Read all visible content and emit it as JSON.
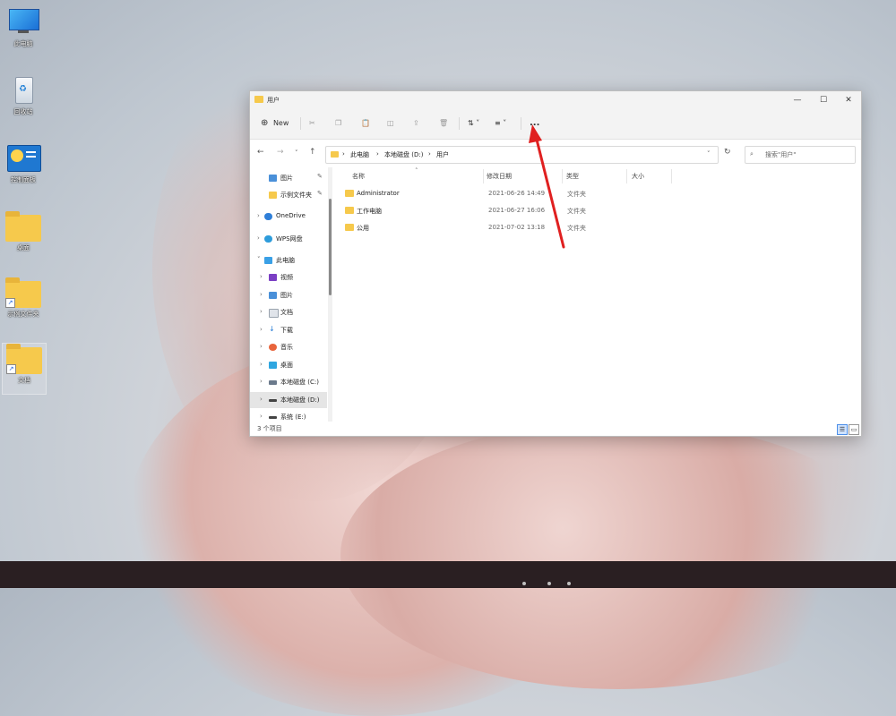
{
  "desktop": {
    "icons": [
      {
        "label": "此电脑",
        "icon": "monitor-icon"
      },
      {
        "label": "回收站",
        "icon": "recycle-bin-icon"
      },
      {
        "label": "控制面板",
        "icon": "control-panel-icon"
      },
      {
        "label": "桌面",
        "icon": "folder-icon"
      },
      {
        "label": "示例文件夹",
        "icon": "folder-shortcut-icon"
      },
      {
        "label": "文档",
        "icon": "folder-shortcut-icon"
      }
    ]
  },
  "window": {
    "title": "用户",
    "controls": {
      "minimize": "—",
      "maximize": "☐",
      "close": "✕"
    },
    "toolbar": {
      "new_label": "New",
      "sort_icon": "sort-icon",
      "view_icon": "view-icon",
      "more_label": "..."
    },
    "address": {
      "segments": [
        "此电脑",
        "本地磁盘 (D:)",
        "用户"
      ],
      "search_placeholder": "搜索\"用户\""
    },
    "nav_pane": [
      {
        "label": "图片",
        "pinned": true
      },
      {
        "label": "示例文件夹",
        "pinned": true
      },
      {
        "label": "OneDrive"
      },
      {
        "label": "WPS网盘"
      },
      {
        "label": "此电脑"
      },
      {
        "label": "视频"
      },
      {
        "label": "图片"
      },
      {
        "label": "文档"
      },
      {
        "label": "下载"
      },
      {
        "label": "音乐"
      },
      {
        "label": "桌面"
      },
      {
        "label": "本地磁盘 (C:)"
      },
      {
        "label": "本地磁盘 (D:)",
        "selected": true
      },
      {
        "label": "系统 (E:)"
      }
    ],
    "columns": [
      "名称",
      "修改日期",
      "类型",
      "大小"
    ],
    "files": [
      {
        "name": "Administrator",
        "date": "2021-06-26 14:49",
        "type": "文件夹"
      },
      {
        "name": "工作电脑",
        "date": "2021-06-27 16:06",
        "type": "文件夹"
      },
      {
        "name": "公用",
        "date": "2021-07-02 13:18",
        "type": "文件夹"
      }
    ],
    "status": "3 个项目",
    "view_buttons": {
      "details": "☰",
      "tiles": "▭"
    },
    "pin_glyph": "📌"
  },
  "colors": {
    "accent": "#e02020",
    "folder": "#f6c94c",
    "taskbar": "#2a1f22"
  }
}
